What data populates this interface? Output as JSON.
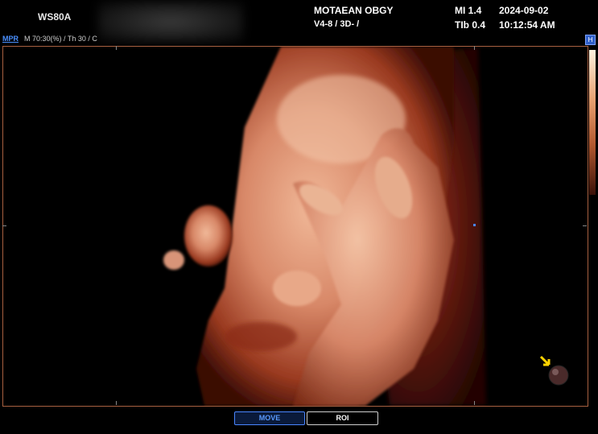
{
  "header": {
    "model": "WS80A",
    "hospital": "MOTAEAN OBGY",
    "probe": "V4-8 / 3D- /",
    "mi": "MI  1.4",
    "tib": "TIb 0.4",
    "date": "2024-09-02",
    "time": "10:12:54 AM"
  },
  "subbar": {
    "mode": "MPR",
    "params": "M 70:30(%) / Th 30 / C",
    "badge": "H"
  },
  "viewport": {
    "render_icon": "orientation-sphere-icon",
    "pointer_icon": "yellow-arrow-icon",
    "colors": {
      "frame": "#a86040",
      "skin": "#d88868"
    }
  },
  "buttons": {
    "move": "MOVE",
    "roi": "ROI"
  },
  "colors": {
    "accent": "#4a86ff"
  }
}
